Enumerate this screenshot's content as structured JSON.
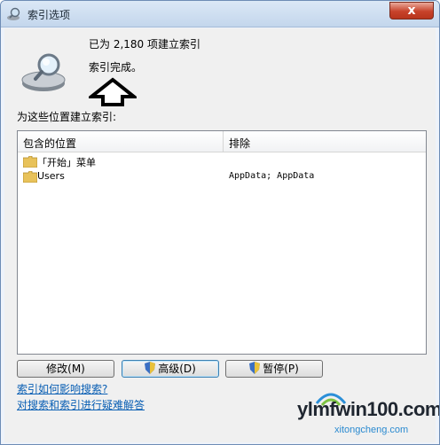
{
  "window": {
    "title": "索引选项",
    "close_glyph": "x"
  },
  "summary": {
    "count_text": "已为 2,180 项建立索引",
    "status_text": "索引完成。"
  },
  "section_label": "为这些位置建立索引:",
  "list": {
    "columns": [
      "包含的位置",
      "排除"
    ],
    "rows": [
      {
        "location": "「开始」菜单",
        "exclude": ""
      },
      {
        "location": "Users",
        "exclude": "AppData; AppData"
      }
    ]
  },
  "buttons": {
    "modify": "修改(M)",
    "advanced": "高级(D)",
    "pause": "暂停(P)"
  },
  "links": {
    "how_index_affects_search": "索引如何影响搜索?",
    "troubleshoot": "对搜索和索引进行疑难解答"
  },
  "watermark": {
    "domain": "ylmfwin100.com",
    "sub": "xitongcheng.com"
  },
  "icons": {
    "title": "magnifier-drive-icon",
    "summary": "indexing-drive-icon",
    "folder": "folder-icon",
    "shield": "uac-shield-icon"
  },
  "colors": {
    "link": "#0a5fb4",
    "close": "#c7422a",
    "accent": "#3c7fb1"
  }
}
